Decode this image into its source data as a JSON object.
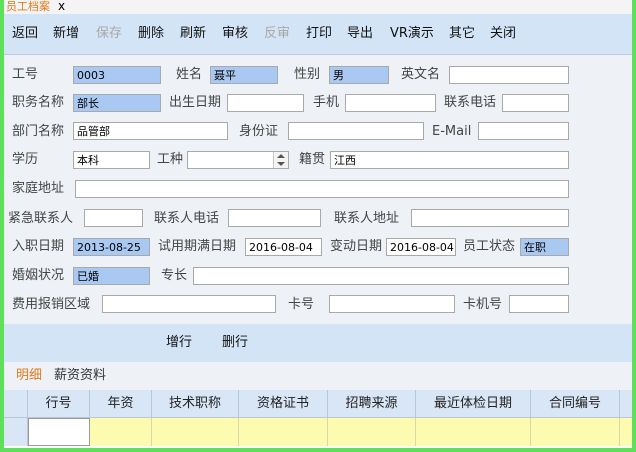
{
  "tab": {
    "title": "员工档案",
    "close": "x"
  },
  "toolbar": {
    "back": "返回",
    "add": "新增",
    "save": "保存",
    "delete": "删除",
    "refresh": "刷新",
    "audit": "审核",
    "unaudit": "反审",
    "print": "打印",
    "export": "导出",
    "vr": "VR演示",
    "other": "其它",
    "close": "关闭"
  },
  "form": {
    "emp_no_label": "工号",
    "emp_no": "0003",
    "name_label": "姓名",
    "name": "聂平",
    "gender_label": "性别",
    "gender": "男",
    "eng_name_label": "英文名",
    "eng_name": "",
    "title_label": "职务名称",
    "title": "部长",
    "birth_label": "出生日期",
    "birth": "",
    "mobile_label": "手机",
    "mobile": "",
    "phone_label": "联系电话",
    "phone": "",
    "dept_label": "部门名称",
    "dept": "品管部",
    "idcard_label": "身份证",
    "idcard": "",
    "email_label": "E-Mail",
    "email": "",
    "edu_label": "学历",
    "edu": "本科",
    "jobtype_label": "工种",
    "jobtype": "",
    "origin_label": "籍贯",
    "origin": "江西",
    "address_label": "家庭地址",
    "address": "",
    "emergency_label": "紧急联系人",
    "emergency": "",
    "contact_phone_label": "联系人电话",
    "contact_phone": "",
    "contact_addr_label": "联系人地址",
    "contact_addr": "",
    "hire_label": "入职日期",
    "hire": "2013-08-25",
    "probation_label": "试用期满日期",
    "probation": "2016-08-04",
    "change_label": "变动日期",
    "change": "2016-08-04",
    "status_label": "员工状态",
    "status": "在职",
    "marital_label": "婚姻状况",
    "marital": "已婚",
    "specialty_label": "专长",
    "specialty": "",
    "expense_label": "费用报销区域",
    "expense": "",
    "card_label": "卡号",
    "card": "",
    "clock_label": "卡机号",
    "clock": ""
  },
  "rowbar": {
    "add_row": "增行",
    "del_row": "删行"
  },
  "detail_tabs": [
    "明细",
    "薪资资料"
  ],
  "grid": {
    "columns": [
      "行号",
      "年资",
      "技术职称",
      "资格证书",
      "招聘来源",
      "最近体检日期",
      "合同编号"
    ]
  }
}
